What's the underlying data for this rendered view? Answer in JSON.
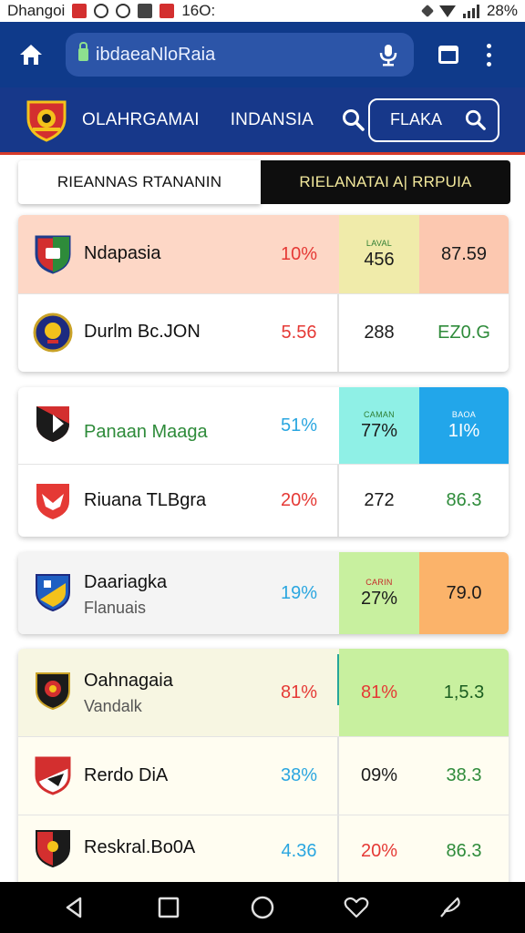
{
  "status_bar": {
    "carrier": "Dhangoi",
    "time": "16O:",
    "battery": "28%"
  },
  "browser": {
    "url": "ibdaeaNloRaia"
  },
  "site": {
    "nav": [
      "OLAHRGAMAI",
      "INDANSIA"
    ],
    "search_label": "FLAKA"
  },
  "tabs": {
    "left": "RIEANNAS RTANANIN",
    "right": "RIELANATAI A| RRPUIA"
  },
  "colors": {
    "header_blue": "#17388a",
    "browser_blue": "#0f3a8a",
    "accent_red": "#d63b2a",
    "peach": "#fdd7c6",
    "yellow_green": "#f0ebaa",
    "cyan": "#8ff0e6",
    "blue": "#22a6ea",
    "light_green": "#c8f09f",
    "orange": "#fbb36a",
    "cream": "#f7f6e2"
  },
  "cards": [
    {
      "rows": [
        {
          "team": "Ndapasia",
          "subtitle": "",
          "crest": "red-green-shield-icon",
          "c1": "10%",
          "c2_tag": "LAVAL",
          "c2": "456",
          "c3_tag": "",
          "c3": "87.59"
        },
        {
          "team": "Durlm Bc.JON",
          "subtitle": "",
          "crest": "navy-round-crest-icon",
          "c1": "5.56",
          "c2_tag": "",
          "c2": "288",
          "c3_tag": "",
          "c3": "EZ0.G"
        }
      ]
    },
    {
      "rows": [
        {
          "team": "Panaan Maaga",
          "subtitle": "",
          "crest": "red-black-shield-icon",
          "c1": "51%",
          "c2_tag": "CAMAN",
          "c2": "77%",
          "c3_tag": "BAOA",
          "c3": "1I%"
        },
        {
          "team": "Riuana TLBgra",
          "subtitle": "",
          "crest": "red-eagle-shield-icon",
          "c1": "20%",
          "c2_tag": "",
          "c2": "272",
          "c3_tag": "",
          "c3": "86.3"
        }
      ]
    },
    {
      "rows": [
        {
          "team": "Daariagka",
          "subtitle": "Flanuais",
          "crest": "blue-yellow-shield-icon",
          "c1": "19%",
          "c2_tag": "CARIN",
          "c2": "27%",
          "c3_tag": "",
          "c3": "79.0"
        }
      ]
    },
    {
      "rows": [
        {
          "team": "Oahnagaia",
          "subtitle": "Vandalk",
          "crest": "black-red-crest-icon",
          "c1": "81%",
          "c2_tag": "",
          "c2": "81%",
          "c3_tag": "",
          "c3": "1,5.3"
        },
        {
          "team": "Rerdo DiA",
          "subtitle": "",
          "crest": "red-white-shield-icon",
          "c1": "38%",
          "c2_tag": "",
          "c2": "09%",
          "c3_tag": "",
          "c3": "38.3"
        },
        {
          "team": "Reskral.Bo0A",
          "subtitle": "",
          "crest": "red-black-badge-icon",
          "c1": "4.36",
          "c2_tag": "",
          "c2": "20%",
          "c3_tag": "",
          "c3": "86.3"
        }
      ]
    }
  ]
}
